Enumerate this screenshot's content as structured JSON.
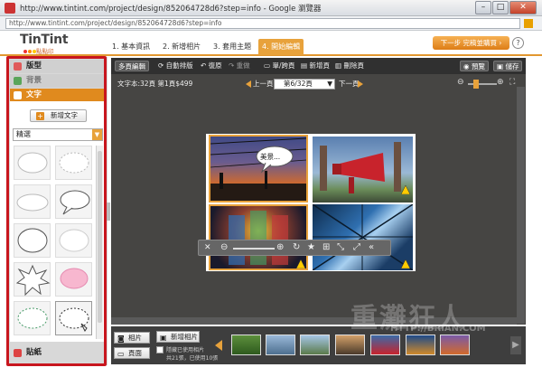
{
  "window": {
    "title": "http://www.tintint.com/project/design/852064728d6?step=info - Google 瀏覽器",
    "url": "http://www.tintint.com/project/design/852064728d6?step=info"
  },
  "brand": {
    "logo": "TinTint",
    "logo_sub": "點點印"
  },
  "steps": [
    {
      "label": "1. 基本資訊"
    },
    {
      "label": "2. 新增相片"
    },
    {
      "label": "3. 套用主題"
    },
    {
      "label": "4. 開始編輯"
    }
  ],
  "next_button": "下一步 完稿並購買 ›",
  "help": "?",
  "sidebar": {
    "sections": [
      {
        "label": "版型"
      },
      {
        "label": "背景"
      },
      {
        "label": "文字"
      }
    ],
    "add_text": "新增文字",
    "filter": "精選",
    "stickers": "貼紙"
  },
  "toolbar": {
    "edit_mode": "多頁編輯",
    "auto_layout": "自動排版",
    "undo": "復原",
    "redo": "重做",
    "single_double": "單/跨頁",
    "add_page": "新增頁",
    "delete_page": "刪除頁",
    "preview": "預覽",
    "save": "儲存"
  },
  "book": {
    "info": "文字本:32頁 第1頁$499",
    "prev": "上一頁",
    "next": "下一頁",
    "current_page": "第6/32頁",
    "bubble_text": "美景..."
  },
  "film": {
    "photos_tab": "相片",
    "pages_tab": "頁面",
    "add_photo": "新增相片",
    "hide_used": "隱藏已使用相片",
    "count": "共21張，已使用10張"
  },
  "watermark": {
    "main": "重灘狂人",
    "sub": "HTTP://BRIAN.COM"
  },
  "colors": {
    "accent": "#e8a23b",
    "highlight": "#c8161e"
  }
}
